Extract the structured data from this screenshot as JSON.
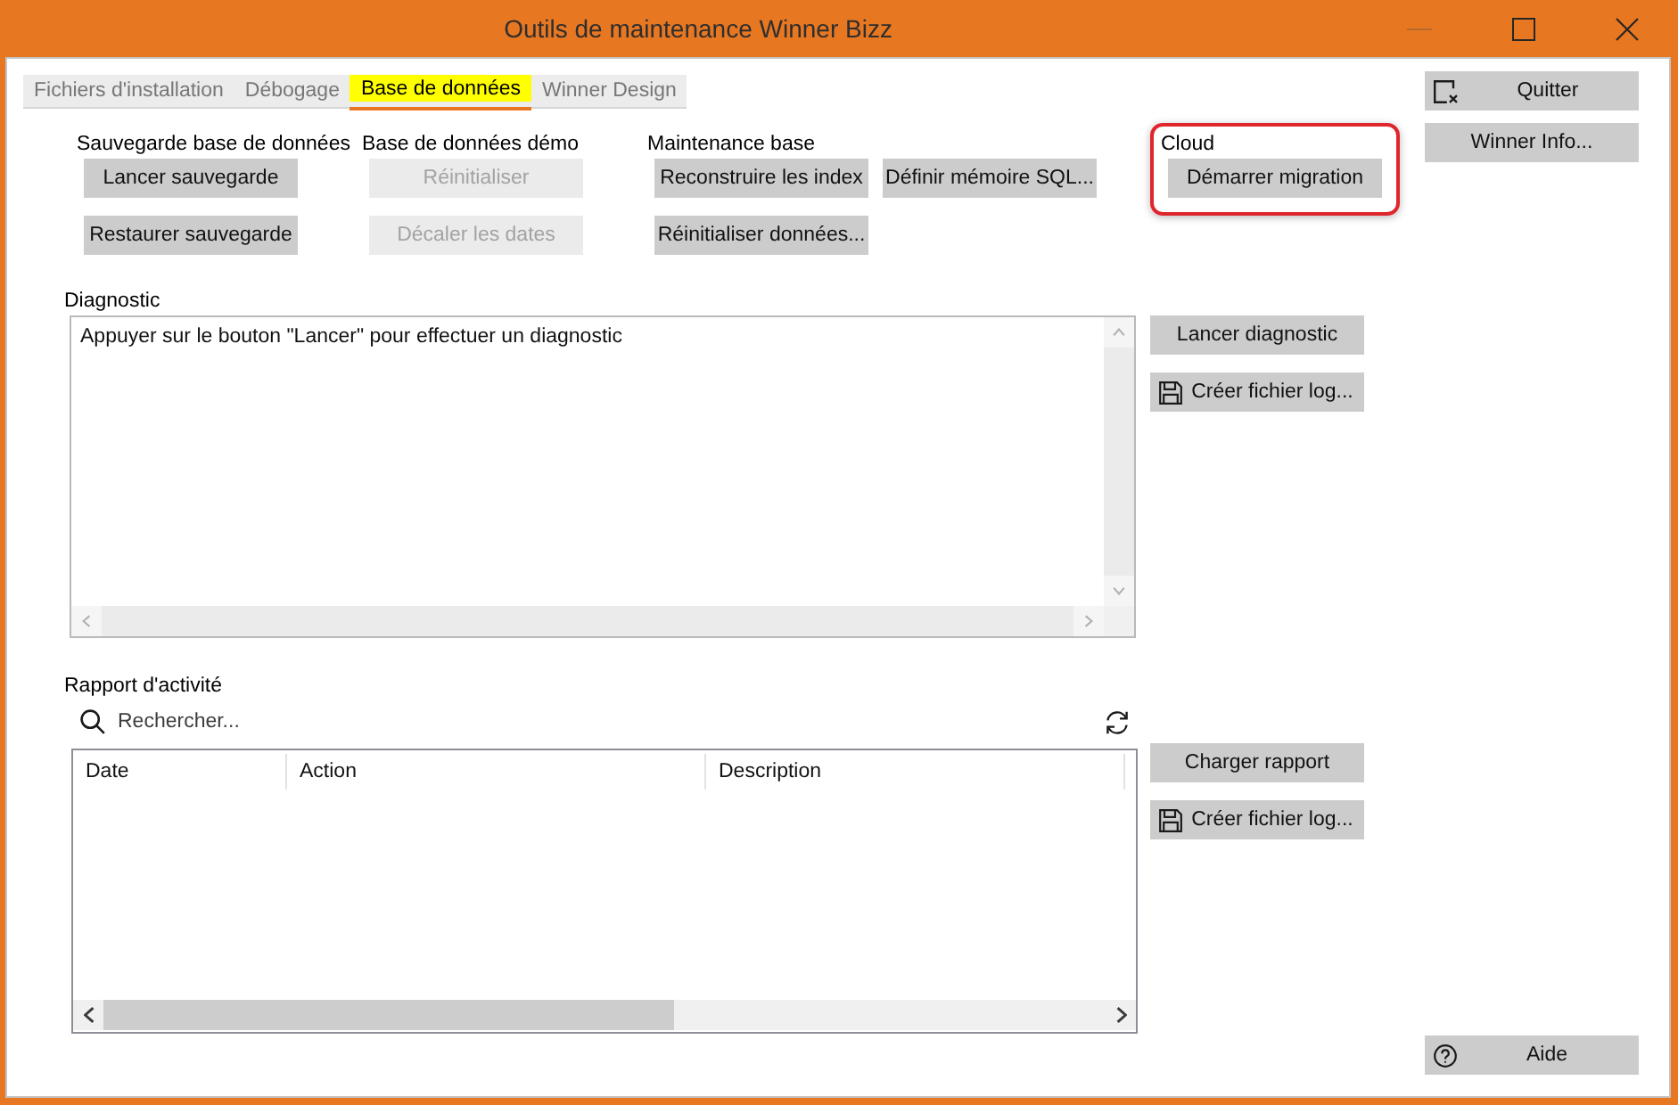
{
  "window": {
    "title": "Outils de maintenance Winner Bizz",
    "controls": [
      {
        "kind": "minimize",
        "disabled": true
      },
      {
        "kind": "maximize",
        "disabled": false
      },
      {
        "kind": "close",
        "disabled": false
      }
    ]
  },
  "tabs": [
    {
      "label": "Fichiers d'installation",
      "selected": false
    },
    {
      "label": "Débogage",
      "selected": false
    },
    {
      "label": "Base de données",
      "selected": true
    },
    {
      "label": "Winner Design",
      "selected": false
    }
  ],
  "groups": [
    {
      "title": "Sauvegarde base de données",
      "highlighted": false,
      "buttons": [
        {
          "label": "Lancer sauvegarde",
          "disabled": false
        },
        {
          "label": "Restaurer sauvegarde",
          "disabled": false
        }
      ]
    },
    {
      "title": "Base de données démo",
      "highlighted": false,
      "buttons": [
        {
          "label": "Réinitialiser",
          "disabled": true
        },
        {
          "label": "Décaler les dates",
          "disabled": true
        }
      ]
    },
    {
      "title": "Maintenance base",
      "highlighted": false,
      "buttons": [
        {
          "label": "Reconstruire les index",
          "disabled": false
        },
        {
          "label": "Définir mémoire SQL...",
          "disabled": false
        },
        {
          "label": "Réinitialiser données...",
          "disabled": false
        }
      ]
    },
    {
      "title": "Cloud",
      "highlighted": true,
      "buttons": [
        {
          "label": "Démarrer migration",
          "disabled": false
        }
      ]
    }
  ],
  "side_buttons": [
    {
      "kind": "exit",
      "label": "Quitter"
    },
    {
      "kind": "plain",
      "label": "Winner Info..."
    }
  ],
  "diagnostic": {
    "title": "Diagnostic",
    "text": "Appuyer sur le bouton \"Lancer\" pour effectuer un diagnostic",
    "buttons": [
      {
        "kind": "plain",
        "label": "Lancer diagnostic"
      },
      {
        "kind": "save",
        "label": "Créer fichier log..."
      }
    ]
  },
  "activity_report": {
    "title": "Rapport d'activité",
    "search": {
      "placeholder": "Rechercher..."
    },
    "table": {
      "columns": [
        "Date",
        "Action",
        "Description"
      ]
    },
    "buttons": [
      {
        "kind": "plain",
        "label": "Charger rapport"
      },
      {
        "kind": "save",
        "label": "Créer fichier log..."
      }
    ]
  },
  "help_button": {
    "kind": "help",
    "label": "Aide"
  }
}
